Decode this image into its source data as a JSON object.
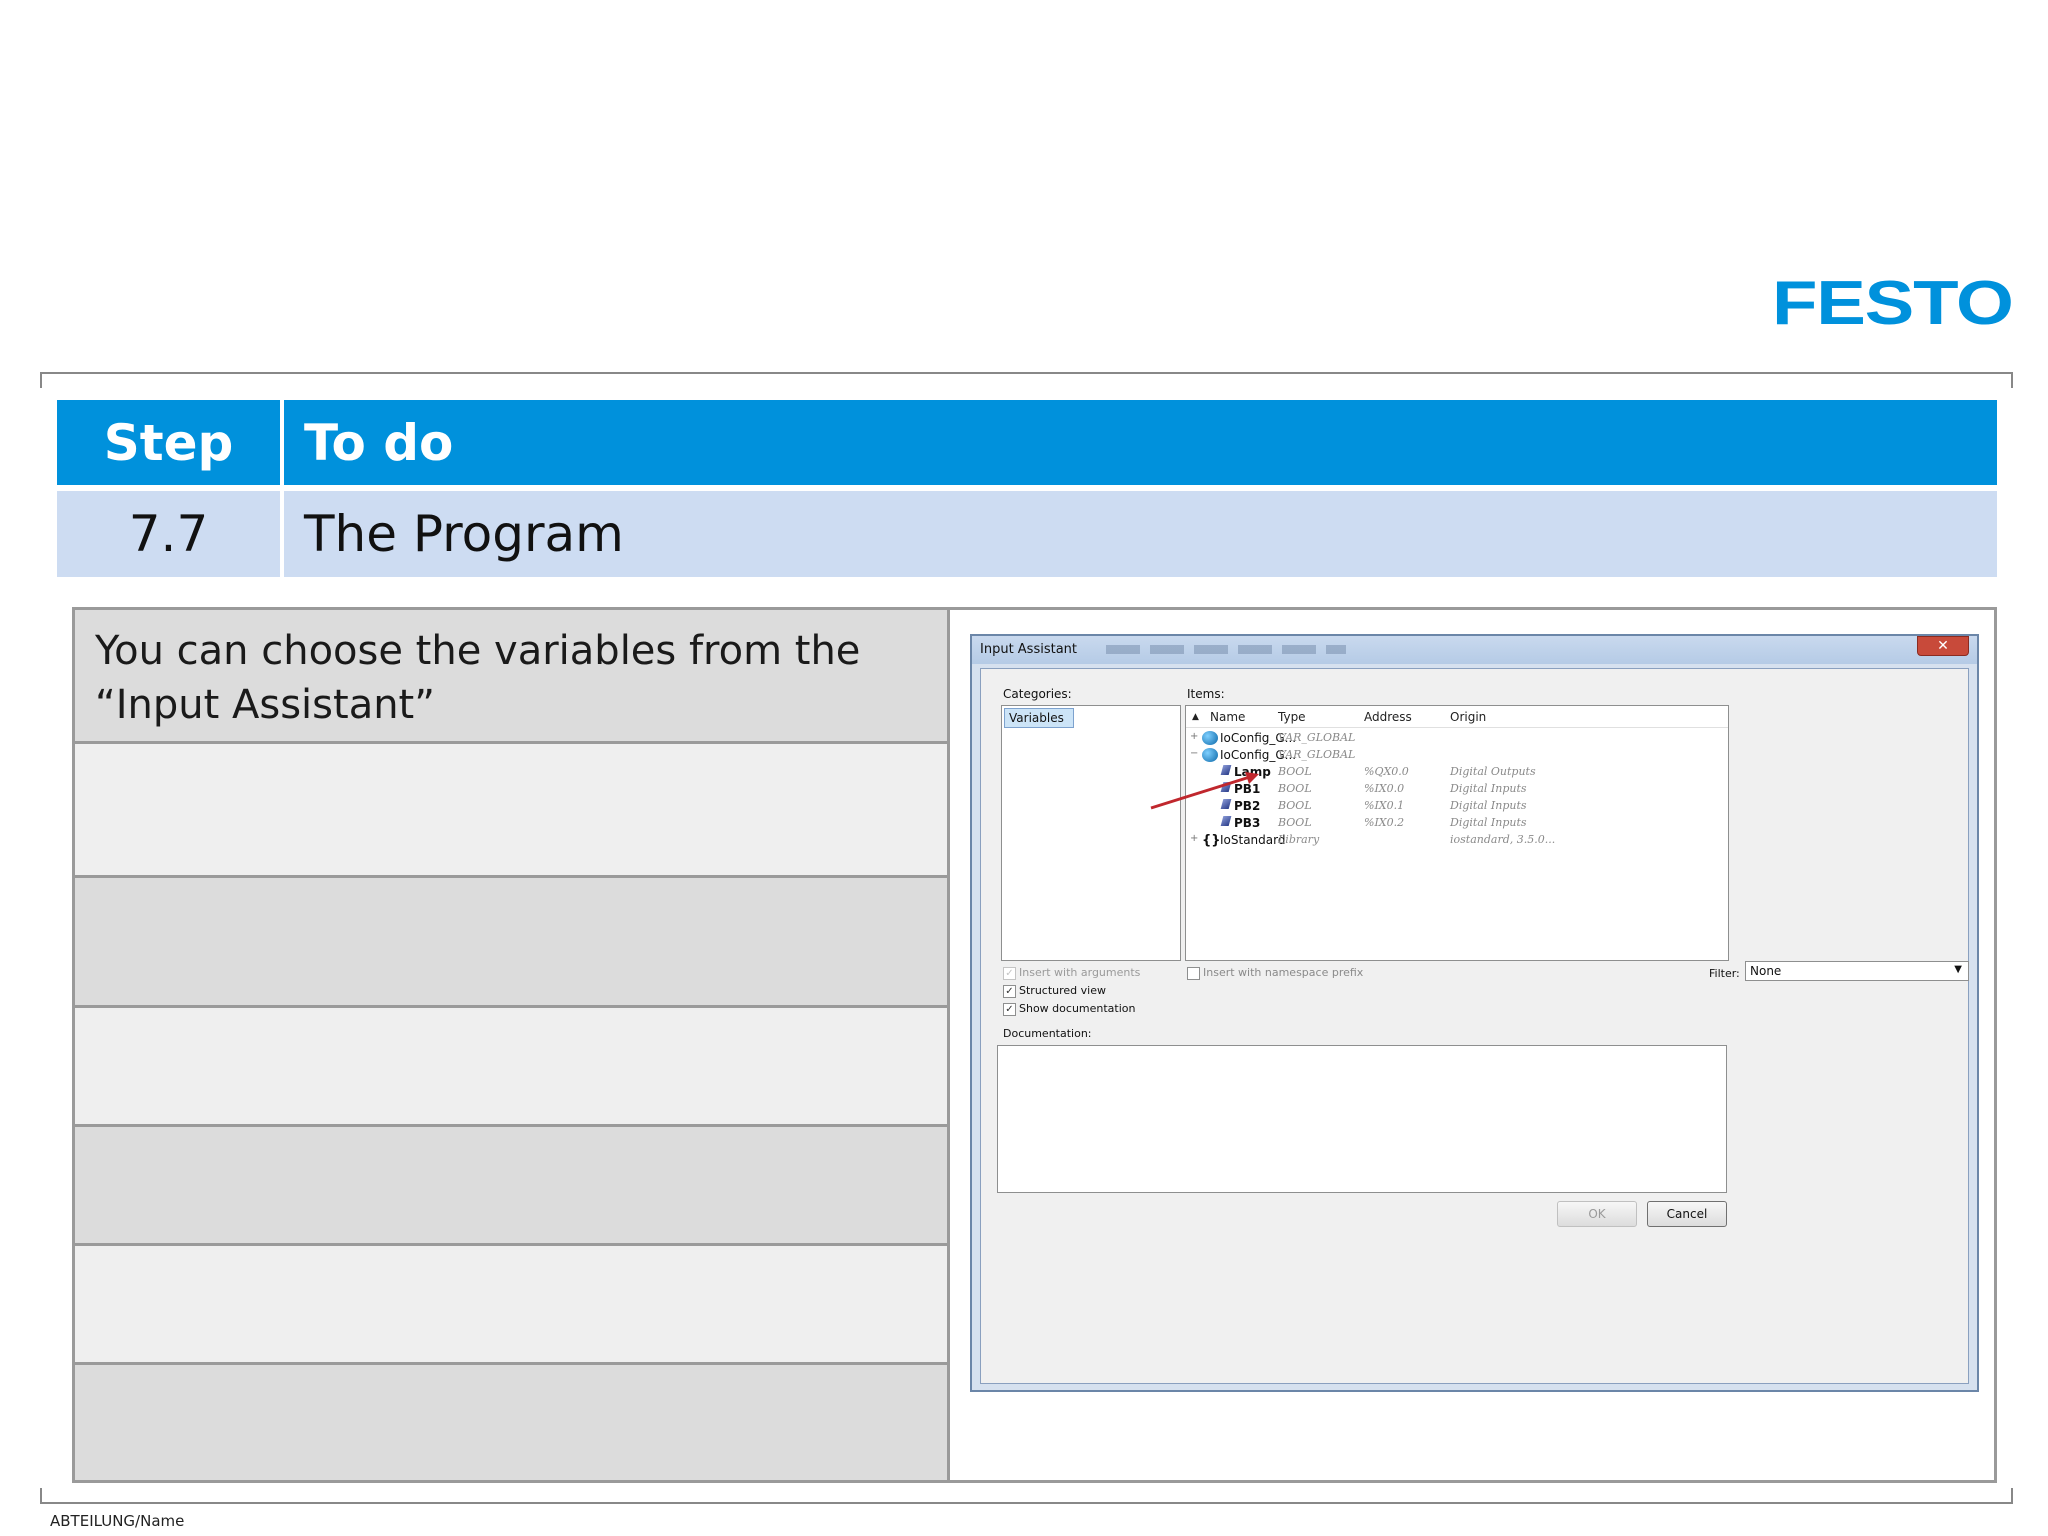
{
  "brand": {
    "logo_text": "FESTO",
    "brand_color": "#0091dc"
  },
  "header": {
    "step_label": "Step",
    "todo_label": "To do",
    "step_number": "7.7",
    "step_title": "The Program"
  },
  "instructions": {
    "line1": "You can choose the variables from the",
    "line2": "“Input Assistant”"
  },
  "dialog": {
    "title": "Input Assistant",
    "close_glyph": "✕",
    "categories_label": "Categories:",
    "categories": [
      "Variables"
    ],
    "items_label": "Items:",
    "columns": {
      "name": "Name",
      "type": "Type",
      "address": "Address",
      "origin": "Origin"
    },
    "rows": [
      {
        "name": "IoConfig_G...",
        "type": "VAR_GLOBAL",
        "address": "",
        "origin": ""
      },
      {
        "name": "IoConfig_G...",
        "type": "VAR_GLOBAL",
        "address": "",
        "origin": ""
      },
      {
        "name": "Lamp",
        "type": "BOOL",
        "address": "%QX0.0",
        "origin": "Digital Outputs"
      },
      {
        "name": "PB1",
        "type": "BOOL",
        "address": "%IX0.0",
        "origin": "Digital Inputs"
      },
      {
        "name": "PB2",
        "type": "BOOL",
        "address": "%IX0.1",
        "origin": "Digital Inputs"
      },
      {
        "name": "PB3",
        "type": "BOOL",
        "address": "%IX0.2",
        "origin": "Digital Inputs"
      },
      {
        "name": "IoStandard",
        "type": "Library",
        "address": "",
        "origin": "iostandard, 3.5.0..."
      }
    ],
    "insert_with_arguments": "Insert with arguments",
    "insert_with_namespace": "Insert with namespace prefix",
    "structured_view": "Structured view",
    "show_documentation": "Show documentation",
    "filter_label": "Filter:",
    "filter_value": "None",
    "documentation_label": "Documentation:",
    "ok_label": "OK",
    "cancel_label": "Cancel"
  },
  "footer": {
    "department": "ABTEILUNG/Name"
  }
}
